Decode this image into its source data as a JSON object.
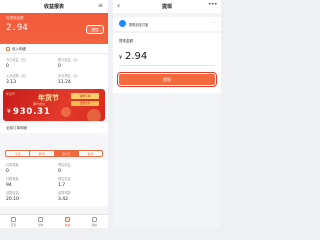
{
  "left": {
    "nav_title": "收益报表",
    "menu_icon": "menu-icon",
    "balance_label": "可提现金额",
    "balance": "2.94",
    "withdraw_button": "提现",
    "income_detail": "收入明细",
    "stats": [
      {
        "label": "今日收益（元）",
        "value": "0"
      },
      {
        "label": "累计收益（元）",
        "value": "0"
      },
      {
        "label": "上月结算（元）",
        "value": "3.13"
      },
      {
        "label": "本月预估（元）",
        "value": "11.24"
      }
    ],
    "banner": {
      "corner_text": "年货节",
      "title": "年货节",
      "ribbon_1": "领券下单",
      "ribbon_2": "立即分享",
      "subtitle": "累计成交",
      "currency": "¥",
      "amount": "930.31"
    },
    "filter_label": "全部订单明细",
    "segments": [
      "今日",
      "昨日",
      "近7日",
      "本月"
    ],
    "grid": [
      {
        "label": "付款笔数",
        "value": "0"
      },
      {
        "label": "预估收益",
        "value": "0"
      },
      {
        "label": "付款笔数",
        "value": "94"
      },
      {
        "label": "预估收益",
        "value": "1.7"
      },
      {
        "label": "结算收益",
        "value": "20.10"
      },
      {
        "label": "结算笔数",
        "value": "3.42"
      }
    ],
    "tabs": [
      {
        "label": "首页",
        "icon": "home-icon"
      },
      {
        "label": "分类",
        "icon": "category-icon"
      },
      {
        "label": "收益",
        "icon": "earnings-icon"
      },
      {
        "label": "我的",
        "icon": "profile-icon"
      }
    ]
  },
  "right": {
    "nav_title": "提现",
    "account_label": "提现到支付宝",
    "amount_label": "提现金额",
    "currency": "¥",
    "amount": "2.94",
    "button": "提现"
  },
  "colors": {
    "accent": "#f36a3f",
    "hero": "#f35a3a",
    "banner": "#d8261e"
  }
}
